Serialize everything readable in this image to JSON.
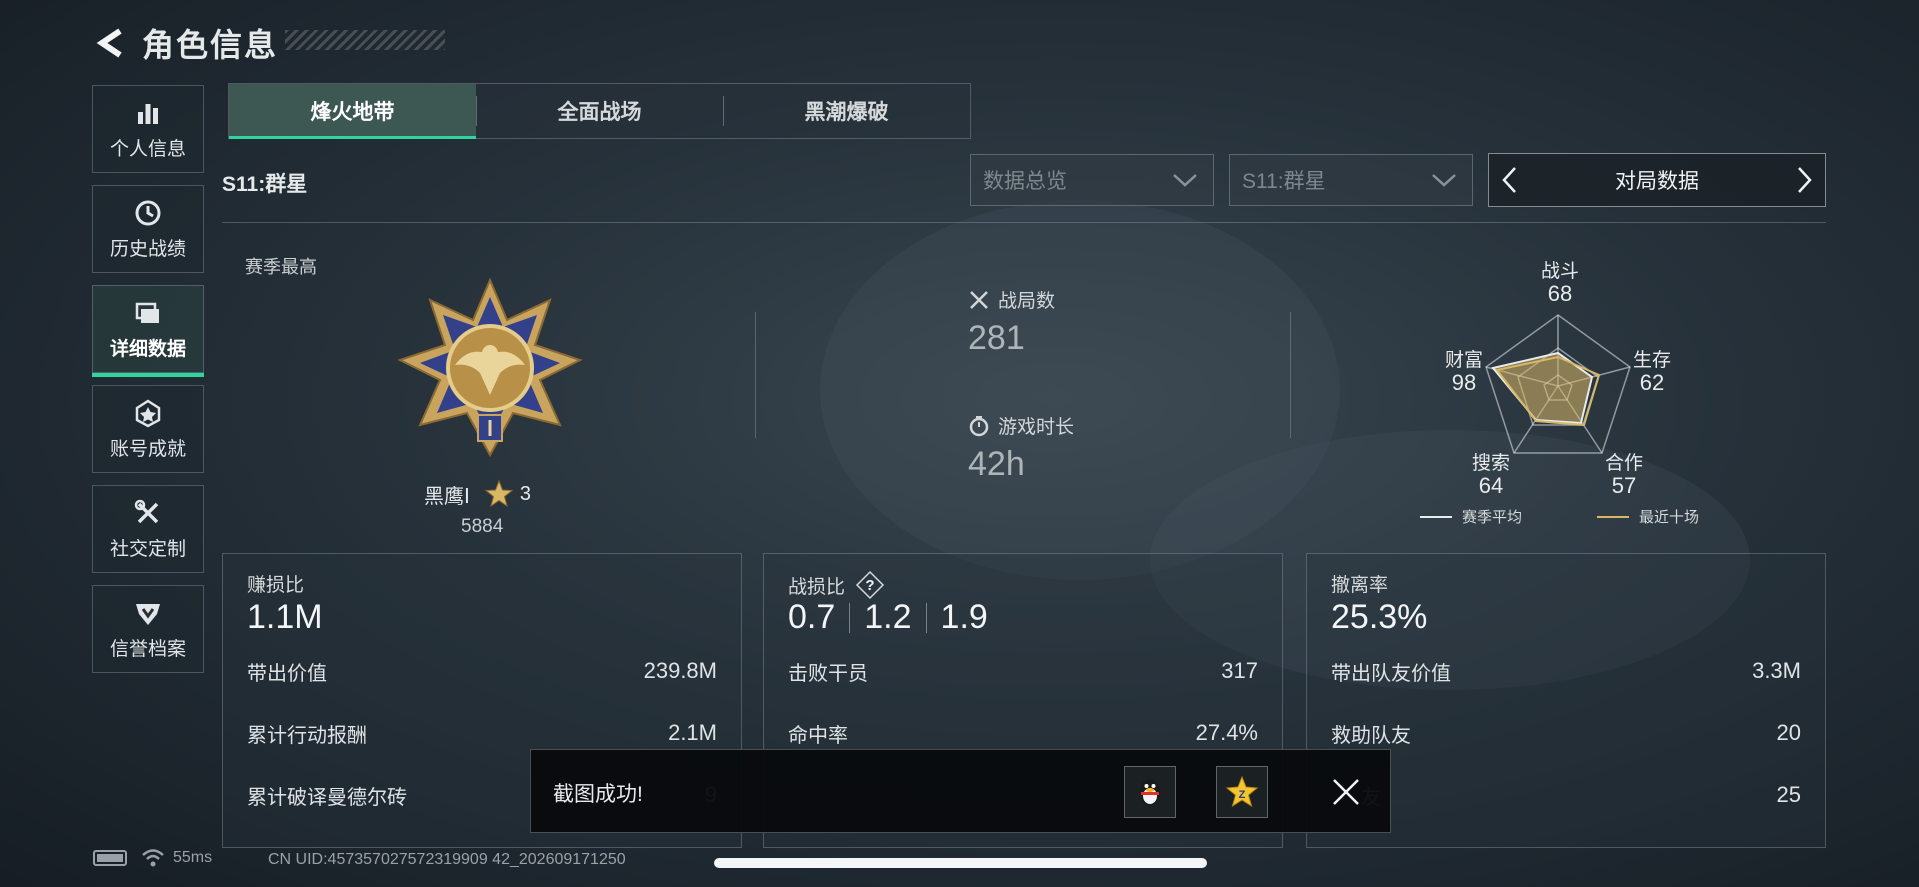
{
  "header": {
    "title": "角色信息"
  },
  "sidebar": {
    "items": [
      {
        "label": "个人信息",
        "icon": "bar-chart-icon",
        "active": false
      },
      {
        "label": "历史战绩",
        "icon": "history-clock-icon",
        "active": false
      },
      {
        "label": "详细数据",
        "icon": "folder-icon",
        "active": true
      },
      {
        "label": "账号成就",
        "icon": "achievement-icon",
        "active": false
      },
      {
        "label": "社交定制",
        "icon": "tools-icon",
        "active": false
      },
      {
        "label": "信誉档案",
        "icon": "credit-shield-icon",
        "active": false
      }
    ]
  },
  "tabs": [
    {
      "label": "烽火地带",
      "active": true
    },
    {
      "label": "全面战场",
      "active": false
    },
    {
      "label": "黑潮爆破",
      "active": false
    }
  ],
  "season_label": "S11:群星",
  "filters": {
    "overview": "数据总览",
    "season": "S11:群星",
    "switcher_label": "对局数据"
  },
  "season_best": {
    "label": "赛季最高",
    "rank_name": "黑鹰Ⅰ",
    "stars": "3",
    "score": "5884"
  },
  "summary": {
    "matches_label": "战局数",
    "matches_value": "281",
    "playtime_label": "游戏时长",
    "playtime_value": "42h"
  },
  "radar": {
    "axes": [
      {
        "name": "战斗",
        "value": "68"
      },
      {
        "name": "生存",
        "value": "62"
      },
      {
        "name": "合作",
        "value": "57"
      },
      {
        "name": "搜索",
        "value": "64"
      },
      {
        "name": "财富",
        "value": "98"
      }
    ],
    "legend": {
      "season_avg": "赛季平均",
      "recent": "最近十场"
    },
    "colors": {
      "season_avg": "#e8ebec",
      "recent": "#d8b765"
    }
  },
  "panels": {
    "profit": {
      "title": "赚损比",
      "big": "1.1M",
      "rows": [
        {
          "label": "带出价值",
          "value": "239.8M"
        },
        {
          "label": "累计行动报酬",
          "value": "2.1M"
        },
        {
          "label": "累计破译曼德尔砖",
          "value": "9"
        }
      ]
    },
    "kd": {
      "title": "战损比",
      "big": [
        "0.7",
        "1.2",
        "1.9"
      ],
      "rows": [
        {
          "label": "击败干员",
          "value": "317"
        },
        {
          "label": "命中率",
          "value": "27.4%"
        },
        {
          "label": "",
          "value": ""
        }
      ]
    },
    "extract": {
      "title": "撤离率",
      "big": "25.3%",
      "rows": [
        {
          "label": "带出队友价值",
          "value": "3.3M"
        },
        {
          "label": "救助队友",
          "value": "20"
        },
        {
          "label": "友",
          "value": "25"
        }
      ]
    }
  },
  "toast": {
    "text": "截图成功!"
  },
  "footer": {
    "ping": "55ms",
    "uid": "CN UID:457357027572319909 42_202609171250"
  },
  "accent_color": "#2fd49e"
}
